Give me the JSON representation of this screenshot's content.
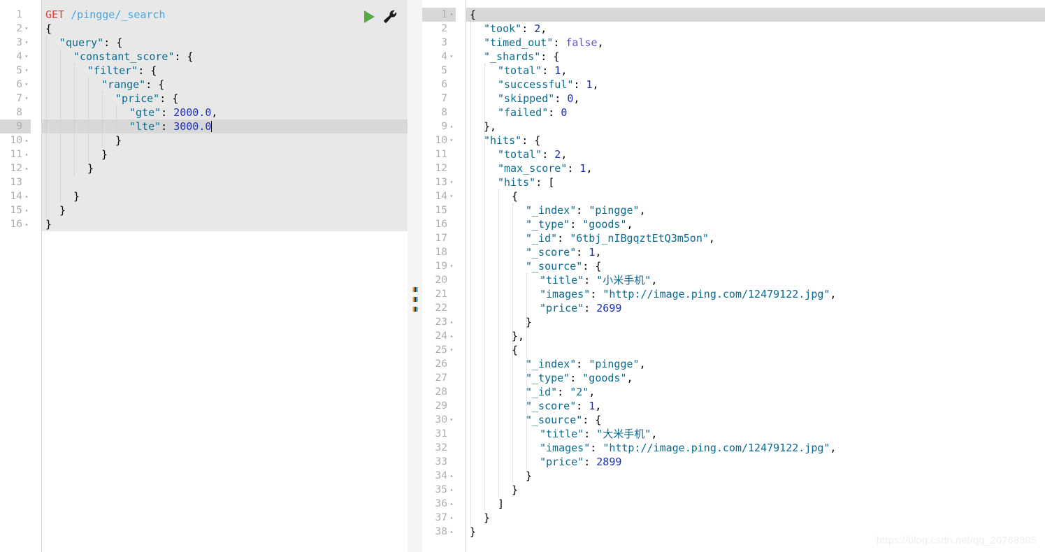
{
  "app": {
    "name": "kibana-dev-tools-console",
    "watermark": "https://blog.csdn.net/qq_20768305"
  },
  "toolbar": {
    "run_icon": "play-icon",
    "run_label": "Click to send request",
    "wrench_icon": "wrench-icon",
    "wrench_label": "Open documentation / auto indent",
    "run_color": "#57a846",
    "wrench_color": "#1c1c1c"
  },
  "splitter": {
    "name": "pane-resize-handle",
    "dots": 3
  },
  "request_editor": {
    "name": "request-editor",
    "active_line": 9,
    "cursor_line": 9,
    "total_lines": 16,
    "method": "GET",
    "path": "/pingge/_search",
    "lines": [
      {
        "n": 1,
        "fold": "none",
        "indent": 0,
        "text": "GET /pingge/_search"
      },
      {
        "n": 2,
        "fold": "down",
        "indent": 0,
        "text": "{"
      },
      {
        "n": 3,
        "fold": "down",
        "indent": 1,
        "text": "\"query\": {"
      },
      {
        "n": 4,
        "fold": "down",
        "indent": 2,
        "text": "\"constant_score\": {"
      },
      {
        "n": 5,
        "fold": "down",
        "indent": 3,
        "text": "\"filter\": {"
      },
      {
        "n": 6,
        "fold": "down",
        "indent": 4,
        "text": "\"range\": {"
      },
      {
        "n": 7,
        "fold": "down",
        "indent": 5,
        "text": "\"price\": {"
      },
      {
        "n": 8,
        "fold": "none",
        "indent": 6,
        "text": "\"gte\": 2000.0,"
      },
      {
        "n": 9,
        "fold": "none",
        "indent": 6,
        "text": "\"lte\": 3000.0"
      },
      {
        "n": 10,
        "fold": "up",
        "indent": 5,
        "text": "}"
      },
      {
        "n": 11,
        "fold": "up",
        "indent": 4,
        "text": "}"
      },
      {
        "n": 12,
        "fold": "up",
        "indent": 3,
        "text": "}"
      },
      {
        "n": 13,
        "fold": "none",
        "indent": 0,
        "text": ""
      },
      {
        "n": 14,
        "fold": "up",
        "indent": 2,
        "text": "}"
      },
      {
        "n": 15,
        "fold": "up",
        "indent": 1,
        "text": "}"
      },
      {
        "n": 16,
        "fold": "up",
        "indent": 0,
        "text": "}"
      }
    ],
    "request_body": {
      "query": {
        "constant_score": {
          "filter": {
            "range": {
              "price": {
                "gte": 2000.0,
                "lte": 3000.0
              }
            }
          }
        }
      }
    }
  },
  "response_editor": {
    "name": "response-editor",
    "active_line": 1,
    "total_lines": 38,
    "lines": [
      {
        "n": 1,
        "fold": "down",
        "indent": 0,
        "text": "{"
      },
      {
        "n": 2,
        "fold": "none",
        "indent": 1,
        "text": "\"took\": 2,"
      },
      {
        "n": 3,
        "fold": "none",
        "indent": 1,
        "text": "\"timed_out\": false,"
      },
      {
        "n": 4,
        "fold": "down",
        "indent": 1,
        "text": "\"_shards\": {"
      },
      {
        "n": 5,
        "fold": "none",
        "indent": 2,
        "text": "\"total\": 1,"
      },
      {
        "n": 6,
        "fold": "none",
        "indent": 2,
        "text": "\"successful\": 1,"
      },
      {
        "n": 7,
        "fold": "none",
        "indent": 2,
        "text": "\"skipped\": 0,"
      },
      {
        "n": 8,
        "fold": "none",
        "indent": 2,
        "text": "\"failed\": 0"
      },
      {
        "n": 9,
        "fold": "up",
        "indent": 1,
        "text": "},"
      },
      {
        "n": 10,
        "fold": "down",
        "indent": 1,
        "text": "\"hits\": {"
      },
      {
        "n": 11,
        "fold": "none",
        "indent": 2,
        "text": "\"total\": 2,"
      },
      {
        "n": 12,
        "fold": "none",
        "indent": 2,
        "text": "\"max_score\": 1,"
      },
      {
        "n": 13,
        "fold": "down",
        "indent": 2,
        "text": "\"hits\": ["
      },
      {
        "n": 14,
        "fold": "down",
        "indent": 3,
        "text": "{"
      },
      {
        "n": 15,
        "fold": "none",
        "indent": 4,
        "text": "\"_index\": \"pingge\","
      },
      {
        "n": 16,
        "fold": "none",
        "indent": 4,
        "text": "\"_type\": \"goods\","
      },
      {
        "n": 17,
        "fold": "none",
        "indent": 4,
        "text": "\"_id\": \"6tbj_nIBgqztEtQ3m5on\","
      },
      {
        "n": 18,
        "fold": "none",
        "indent": 4,
        "text": "\"_score\": 1,"
      },
      {
        "n": 19,
        "fold": "down",
        "indent": 4,
        "text": "\"_source\": {"
      },
      {
        "n": 20,
        "fold": "none",
        "indent": 5,
        "text": "\"title\": \"小米手机\","
      },
      {
        "n": 21,
        "fold": "none",
        "indent": 5,
        "text": "\"images\": \"http://image.ping.com/12479122.jpg\","
      },
      {
        "n": 22,
        "fold": "none",
        "indent": 5,
        "text": "\"price\": 2699"
      },
      {
        "n": 23,
        "fold": "up",
        "indent": 4,
        "text": "}"
      },
      {
        "n": 24,
        "fold": "up",
        "indent": 3,
        "text": "},"
      },
      {
        "n": 25,
        "fold": "down",
        "indent": 3,
        "text": "{"
      },
      {
        "n": 26,
        "fold": "none",
        "indent": 4,
        "text": "\"_index\": \"pingge\","
      },
      {
        "n": 27,
        "fold": "none",
        "indent": 4,
        "text": "\"_type\": \"goods\","
      },
      {
        "n": 28,
        "fold": "none",
        "indent": 4,
        "text": "\"_id\": \"2\","
      },
      {
        "n": 29,
        "fold": "none",
        "indent": 4,
        "text": "\"_score\": 1,"
      },
      {
        "n": 30,
        "fold": "down",
        "indent": 4,
        "text": "\"_source\": {"
      },
      {
        "n": 31,
        "fold": "none",
        "indent": 5,
        "text": "\"title\": \"大米手机\","
      },
      {
        "n": 32,
        "fold": "none",
        "indent": 5,
        "text": "\"images\": \"http://image.ping.com/12479122.jpg\","
      },
      {
        "n": 33,
        "fold": "none",
        "indent": 5,
        "text": "\"price\": 2899"
      },
      {
        "n": 34,
        "fold": "up",
        "indent": 4,
        "text": "}"
      },
      {
        "n": 35,
        "fold": "up",
        "indent": 3,
        "text": "}"
      },
      {
        "n": 36,
        "fold": "up",
        "indent": 2,
        "text": "]"
      },
      {
        "n": 37,
        "fold": "up",
        "indent": 1,
        "text": "}"
      },
      {
        "n": 38,
        "fold": "up",
        "indent": 0,
        "text": "}"
      }
    ],
    "response_body": {
      "took": 2,
      "timed_out": false,
      "_shards": {
        "total": 1,
        "successful": 1,
        "skipped": 0,
        "failed": 0
      },
      "hits": {
        "total": 2,
        "max_score": 1,
        "hits": [
          {
            "_index": "pingge",
            "_type": "goods",
            "_id": "6tbj_nIBgqztEtQ3m5on",
            "_score": 1,
            "_source": {
              "title": "小米手机",
              "images": "http://image.ping.com/12479122.jpg",
              "price": 2699
            }
          },
          {
            "_index": "pingge",
            "_type": "goods",
            "_id": "2",
            "_score": 1,
            "_source": {
              "title": "大米手机",
              "images": "http://image.ping.com/12479122.jpg",
              "price": 2899
            }
          }
        ]
      }
    }
  },
  "colors": {
    "editor_bg": "#e8e8e8",
    "page_bg": "#ffffff",
    "active_line": "#d8d8d8",
    "gutter_text": "#adadad",
    "key": "#0b6a8f",
    "number": "#1b30b5",
    "boolean": "#6a4fd6",
    "method": "#d9463e",
    "url": "#4aa3df"
  }
}
